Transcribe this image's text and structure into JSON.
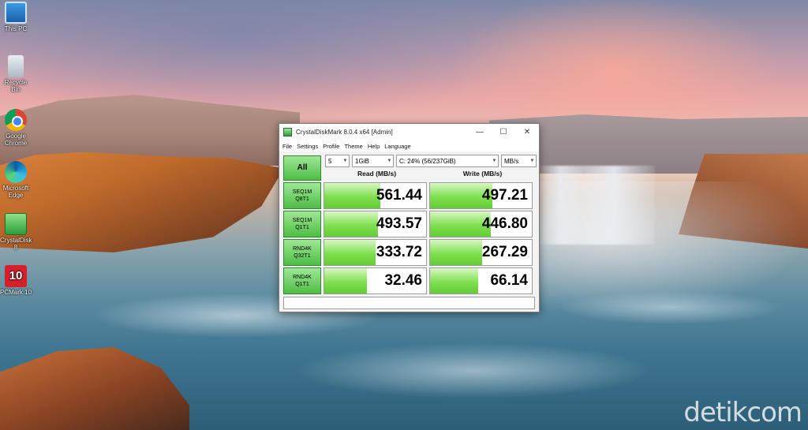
{
  "desktop": {
    "icons": [
      {
        "label": "This PC",
        "glyph": "pc-icon"
      },
      {
        "label": "Recycle Bin",
        "glyph": "recycle-bin-icon"
      },
      {
        "label": "Google Chrome",
        "glyph": "chrome-icon"
      },
      {
        "label": "Microsoft Edge",
        "glyph": "edge-icon"
      },
      {
        "label": "CrystalDisk 8",
        "glyph": "crystaldiskmark-icon"
      },
      {
        "label": "PCMark 10",
        "glyph": "pcmark-icon"
      }
    ],
    "pcmark_glyph_text": "10",
    "watermark": "detikcom"
  },
  "window": {
    "title": "CrystalDiskMark 8.0.4 x64 [Admin]",
    "minimize_glyph": "—",
    "maximize_glyph": "☐",
    "close_glyph": "✕",
    "menu": [
      "File",
      "Settings",
      "Profile",
      "Theme",
      "Help",
      "Language"
    ],
    "all_button": "All",
    "count_select": "5",
    "size_select": "1GiB",
    "drive_select": "C: 24% (56/237GiB)",
    "unit_select": "MB/s",
    "read_header": "Read (MB/s)",
    "write_header": "Write (MB/s)",
    "comment": ""
  },
  "results": [
    {
      "line1": "SEQ1M",
      "line2": "Q8T1",
      "read": "561.44",
      "write": "497.21",
      "read_fill": 0.55,
      "write_fill": 0.61
    },
    {
      "line1": "SEQ1M",
      "line2": "Q1T1",
      "read": "493.57",
      "write": "446.80",
      "read_fill": 0.53,
      "write_fill": 0.6
    },
    {
      "line1": "RND4K",
      "line2": "Q32T1",
      "read": "333.72",
      "write": "267.29",
      "read_fill": 0.5,
      "write_fill": 0.51
    },
    {
      "line1": "RND4K",
      "line2": "Q1T1",
      "read": "32.46",
      "write": "66.14",
      "read_fill": 0.42,
      "write_fill": 0.47
    }
  ],
  "colors": {
    "accent_green": "#4dbd45",
    "bar_green": "#7fe04f"
  }
}
